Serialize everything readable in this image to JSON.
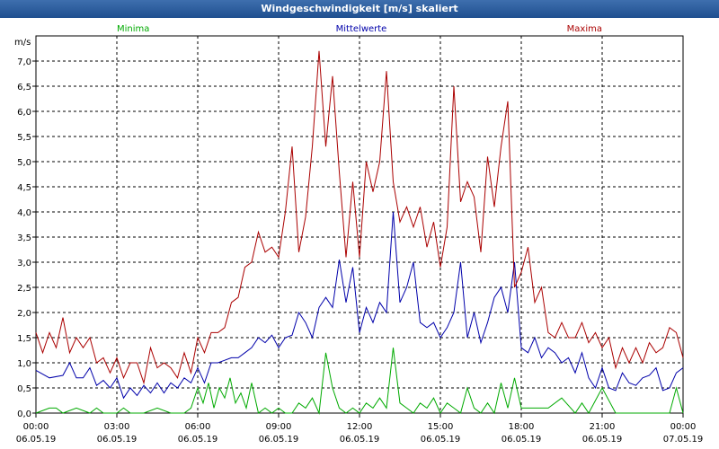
{
  "window": {
    "title": "Windgeschwindigkeit [m/s] skaliert"
  },
  "colors": {
    "minima": "#00aa00",
    "mittelwerte": "#0000aa",
    "maxima": "#aa0000",
    "grid": "#000000"
  },
  "chart_data": {
    "type": "line",
    "title": "Windgeschwindigkeit [m/s] skaliert",
    "ylabel": "m/s",
    "ylim": [
      0,
      7.5
    ],
    "yticks": [
      "0,0",
      "0,5",
      "1,0",
      "1,5",
      "2,0",
      "2,5",
      "3,0",
      "3,5",
      "4,0",
      "4,5",
      "5,0",
      "5,5",
      "6,0",
      "6,5",
      "7,0"
    ],
    "xticks": [
      {
        "time": "00:00",
        "date": "06.05.19"
      },
      {
        "time": "03:00",
        "date": "06.05.19"
      },
      {
        "time": "06:00",
        "date": "06.05.19"
      },
      {
        "time": "09:00",
        "date": "06.05.19"
      },
      {
        "time": "12:00",
        "date": "06.05.19"
      },
      {
        "time": "15:00",
        "date": "06.05.19"
      },
      {
        "time": "18:00",
        "date": "06.05.19"
      },
      {
        "time": "21:00",
        "date": "06.05.19"
      },
      {
        "time": "00:00",
        "date": "07.05.19"
      }
    ],
    "grid": true,
    "legend_position": "top",
    "series": [
      {
        "name": "Minima",
        "x": [
          0,
          0.5,
          0.75,
          1,
          1.5,
          2,
          2.25,
          2.5,
          3,
          3.25,
          3.5,
          4,
          4.5,
          5,
          5.5,
          5.75,
          6,
          6.2,
          6.4,
          6.6,
          6.8,
          7,
          7.2,
          7.4,
          7.6,
          7.8,
          8,
          8.25,
          8.5,
          8.75,
          9,
          9.25,
          9.5,
          9.75,
          10,
          10.25,
          10.5,
          10.75,
          11,
          11.25,
          11.5,
          11.75,
          12,
          12.25,
          12.5,
          12.75,
          13,
          13.25,
          13.5,
          13.75,
          14,
          14.25,
          14.5,
          14.75,
          15,
          15.25,
          15.5,
          15.75,
          16,
          16.25,
          16.5,
          16.75,
          17,
          17.25,
          17.5,
          17.75,
          18,
          18.5,
          19,
          19.5,
          20,
          20.25,
          20.5,
          21,
          21.5,
          22,
          22.5,
          23,
          23.5,
          23.75,
          24
        ],
        "values": [
          0.0,
          0.1,
          0.1,
          0.0,
          0.1,
          0.0,
          0.1,
          0.0,
          0.0,
          0.1,
          0.0,
          0.0,
          0.1,
          0.0,
          0.0,
          0.1,
          0.5,
          0.2,
          0.6,
          0.1,
          0.5,
          0.3,
          0.7,
          0.2,
          0.4,
          0.1,
          0.6,
          0.0,
          0.1,
          0.0,
          0.1,
          0.0,
          0.0,
          0.2,
          0.1,
          0.3,
          0.0,
          1.2,
          0.5,
          0.1,
          0.0,
          0.1,
          0.0,
          0.2,
          0.1,
          0.3,
          0.1,
          1.3,
          0.2,
          0.1,
          0.0,
          0.2,
          0.1,
          0.3,
          0.0,
          0.2,
          0.1,
          0.0,
          0.5,
          0.1,
          0.0,
          0.2,
          0.0,
          0.6,
          0.1,
          0.7,
          0.1,
          0.1,
          0.1,
          0.3,
          0.0,
          0.2,
          0.0,
          0.5,
          0.0,
          0.0,
          0.0,
          0.0,
          0.0,
          0.5,
          0.0
        ]
      },
      {
        "name": "Mittelwerte",
        "x": [
          0,
          0.5,
          1,
          1.25,
          1.5,
          1.75,
          2,
          2.25,
          2.5,
          2.75,
          3,
          3.25,
          3.5,
          3.75,
          4,
          4.25,
          4.5,
          4.75,
          5,
          5.25,
          5.5,
          5.75,
          6,
          6.25,
          6.5,
          6.75,
          7,
          7.25,
          7.5,
          7.75,
          8,
          8.25,
          8.5,
          8.75,
          9,
          9.25,
          9.5,
          9.75,
          10,
          10.25,
          10.5,
          10.75,
          11,
          11.25,
          11.5,
          11.75,
          12,
          12.25,
          12.5,
          12.75,
          13,
          13.25,
          13.5,
          13.75,
          14,
          14.25,
          14.5,
          14.75,
          15,
          15.25,
          15.5,
          15.75,
          16,
          16.25,
          16.5,
          16.75,
          17,
          17.25,
          17.5,
          17.75,
          18,
          18.25,
          18.5,
          18.75,
          19,
          19.25,
          19.5,
          19.75,
          20,
          20.25,
          20.5,
          20.75,
          21,
          21.25,
          21.5,
          21.75,
          22,
          22.25,
          22.5,
          22.75,
          23,
          23.25,
          23.5,
          23.75,
          24
        ],
        "values": [
          0.85,
          0.7,
          0.75,
          1.0,
          0.7,
          0.7,
          0.9,
          0.55,
          0.65,
          0.5,
          0.7,
          0.3,
          0.5,
          0.35,
          0.55,
          0.4,
          0.6,
          0.4,
          0.6,
          0.5,
          0.7,
          0.6,
          0.9,
          0.6,
          1.0,
          1.0,
          1.05,
          1.1,
          1.1,
          1.2,
          1.3,
          1.5,
          1.4,
          1.55,
          1.3,
          1.5,
          1.55,
          2.0,
          1.8,
          1.5,
          2.1,
          2.3,
          2.1,
          3.05,
          2.2,
          2.9,
          1.6,
          2.1,
          1.8,
          2.2,
          2.0,
          4.0,
          2.2,
          2.5,
          3.0,
          1.8,
          1.7,
          1.8,
          1.5,
          1.7,
          2.0,
          3.0,
          1.5,
          2.0,
          1.4,
          1.8,
          2.3,
          2.5,
          2.0,
          3.0,
          1.3,
          1.2,
          1.5,
          1.1,
          1.3,
          1.2,
          1.0,
          1.1,
          0.8,
          1.2,
          0.7,
          0.5,
          0.9,
          0.5,
          0.45,
          0.8,
          0.6,
          0.55,
          0.7,
          0.75,
          0.9,
          0.45,
          0.5,
          0.8,
          0.9
        ]
      },
      {
        "name": "Maxima",
        "x": [
          0,
          0.25,
          0.5,
          0.75,
          1,
          1.25,
          1.5,
          1.75,
          2,
          2.25,
          2.5,
          2.75,
          3,
          3.25,
          3.5,
          3.75,
          4,
          4.25,
          4.5,
          4.75,
          5,
          5.25,
          5.5,
          5.75,
          6,
          6.25,
          6.5,
          6.75,
          7,
          7.25,
          7.5,
          7.75,
          8,
          8.25,
          8.5,
          8.75,
          9,
          9.25,
          9.5,
          9.75,
          10,
          10.25,
          10.5,
          10.75,
          11,
          11.25,
          11.5,
          11.75,
          12,
          12.25,
          12.5,
          12.75,
          13,
          13.25,
          13.5,
          13.75,
          14,
          14.25,
          14.5,
          14.75,
          15,
          15.25,
          15.5,
          15.75,
          16,
          16.25,
          16.5,
          16.75,
          17,
          17.25,
          17.5,
          17.75,
          18,
          18.25,
          18.5,
          18.75,
          19,
          19.25,
          19.5,
          19.75,
          20,
          20.25,
          20.5,
          20.75,
          21,
          21.25,
          21.5,
          21.75,
          22,
          22.25,
          22.5,
          22.75,
          23,
          23.25,
          23.5,
          23.75,
          24
        ],
        "values": [
          1.6,
          1.2,
          1.6,
          1.3,
          1.9,
          1.2,
          1.5,
          1.3,
          1.5,
          1.0,
          1.1,
          0.8,
          1.1,
          0.7,
          1.0,
          1.0,
          0.6,
          1.3,
          0.9,
          1.0,
          0.9,
          0.7,
          1.2,
          0.8,
          1.5,
          1.2,
          1.6,
          1.6,
          1.7,
          2.2,
          2.3,
          2.9,
          3.0,
          3.6,
          3.2,
          3.3,
          3.1,
          4.0,
          5.3,
          3.2,
          3.9,
          5.3,
          7.2,
          5.3,
          6.7,
          4.8,
          3.1,
          4.6,
          3.1,
          5.0,
          4.4,
          5.0,
          6.8,
          4.6,
          3.8,
          4.1,
          3.7,
          4.1,
          3.3,
          3.8,
          2.9,
          3.7,
          6.5,
          4.2,
          4.6,
          4.3,
          3.2,
          5.1,
          4.1,
          5.3,
          6.2,
          2.5,
          2.8,
          3.3,
          2.2,
          2.5,
          1.6,
          1.5,
          1.8,
          1.5,
          1.5,
          1.8,
          1.4,
          1.6,
          1.3,
          1.5,
          0.9,
          1.3,
          1.0,
          1.3,
          1.0,
          1.4,
          1.2,
          1.3,
          1.7,
          1.6,
          1.1
        ]
      }
    ]
  }
}
